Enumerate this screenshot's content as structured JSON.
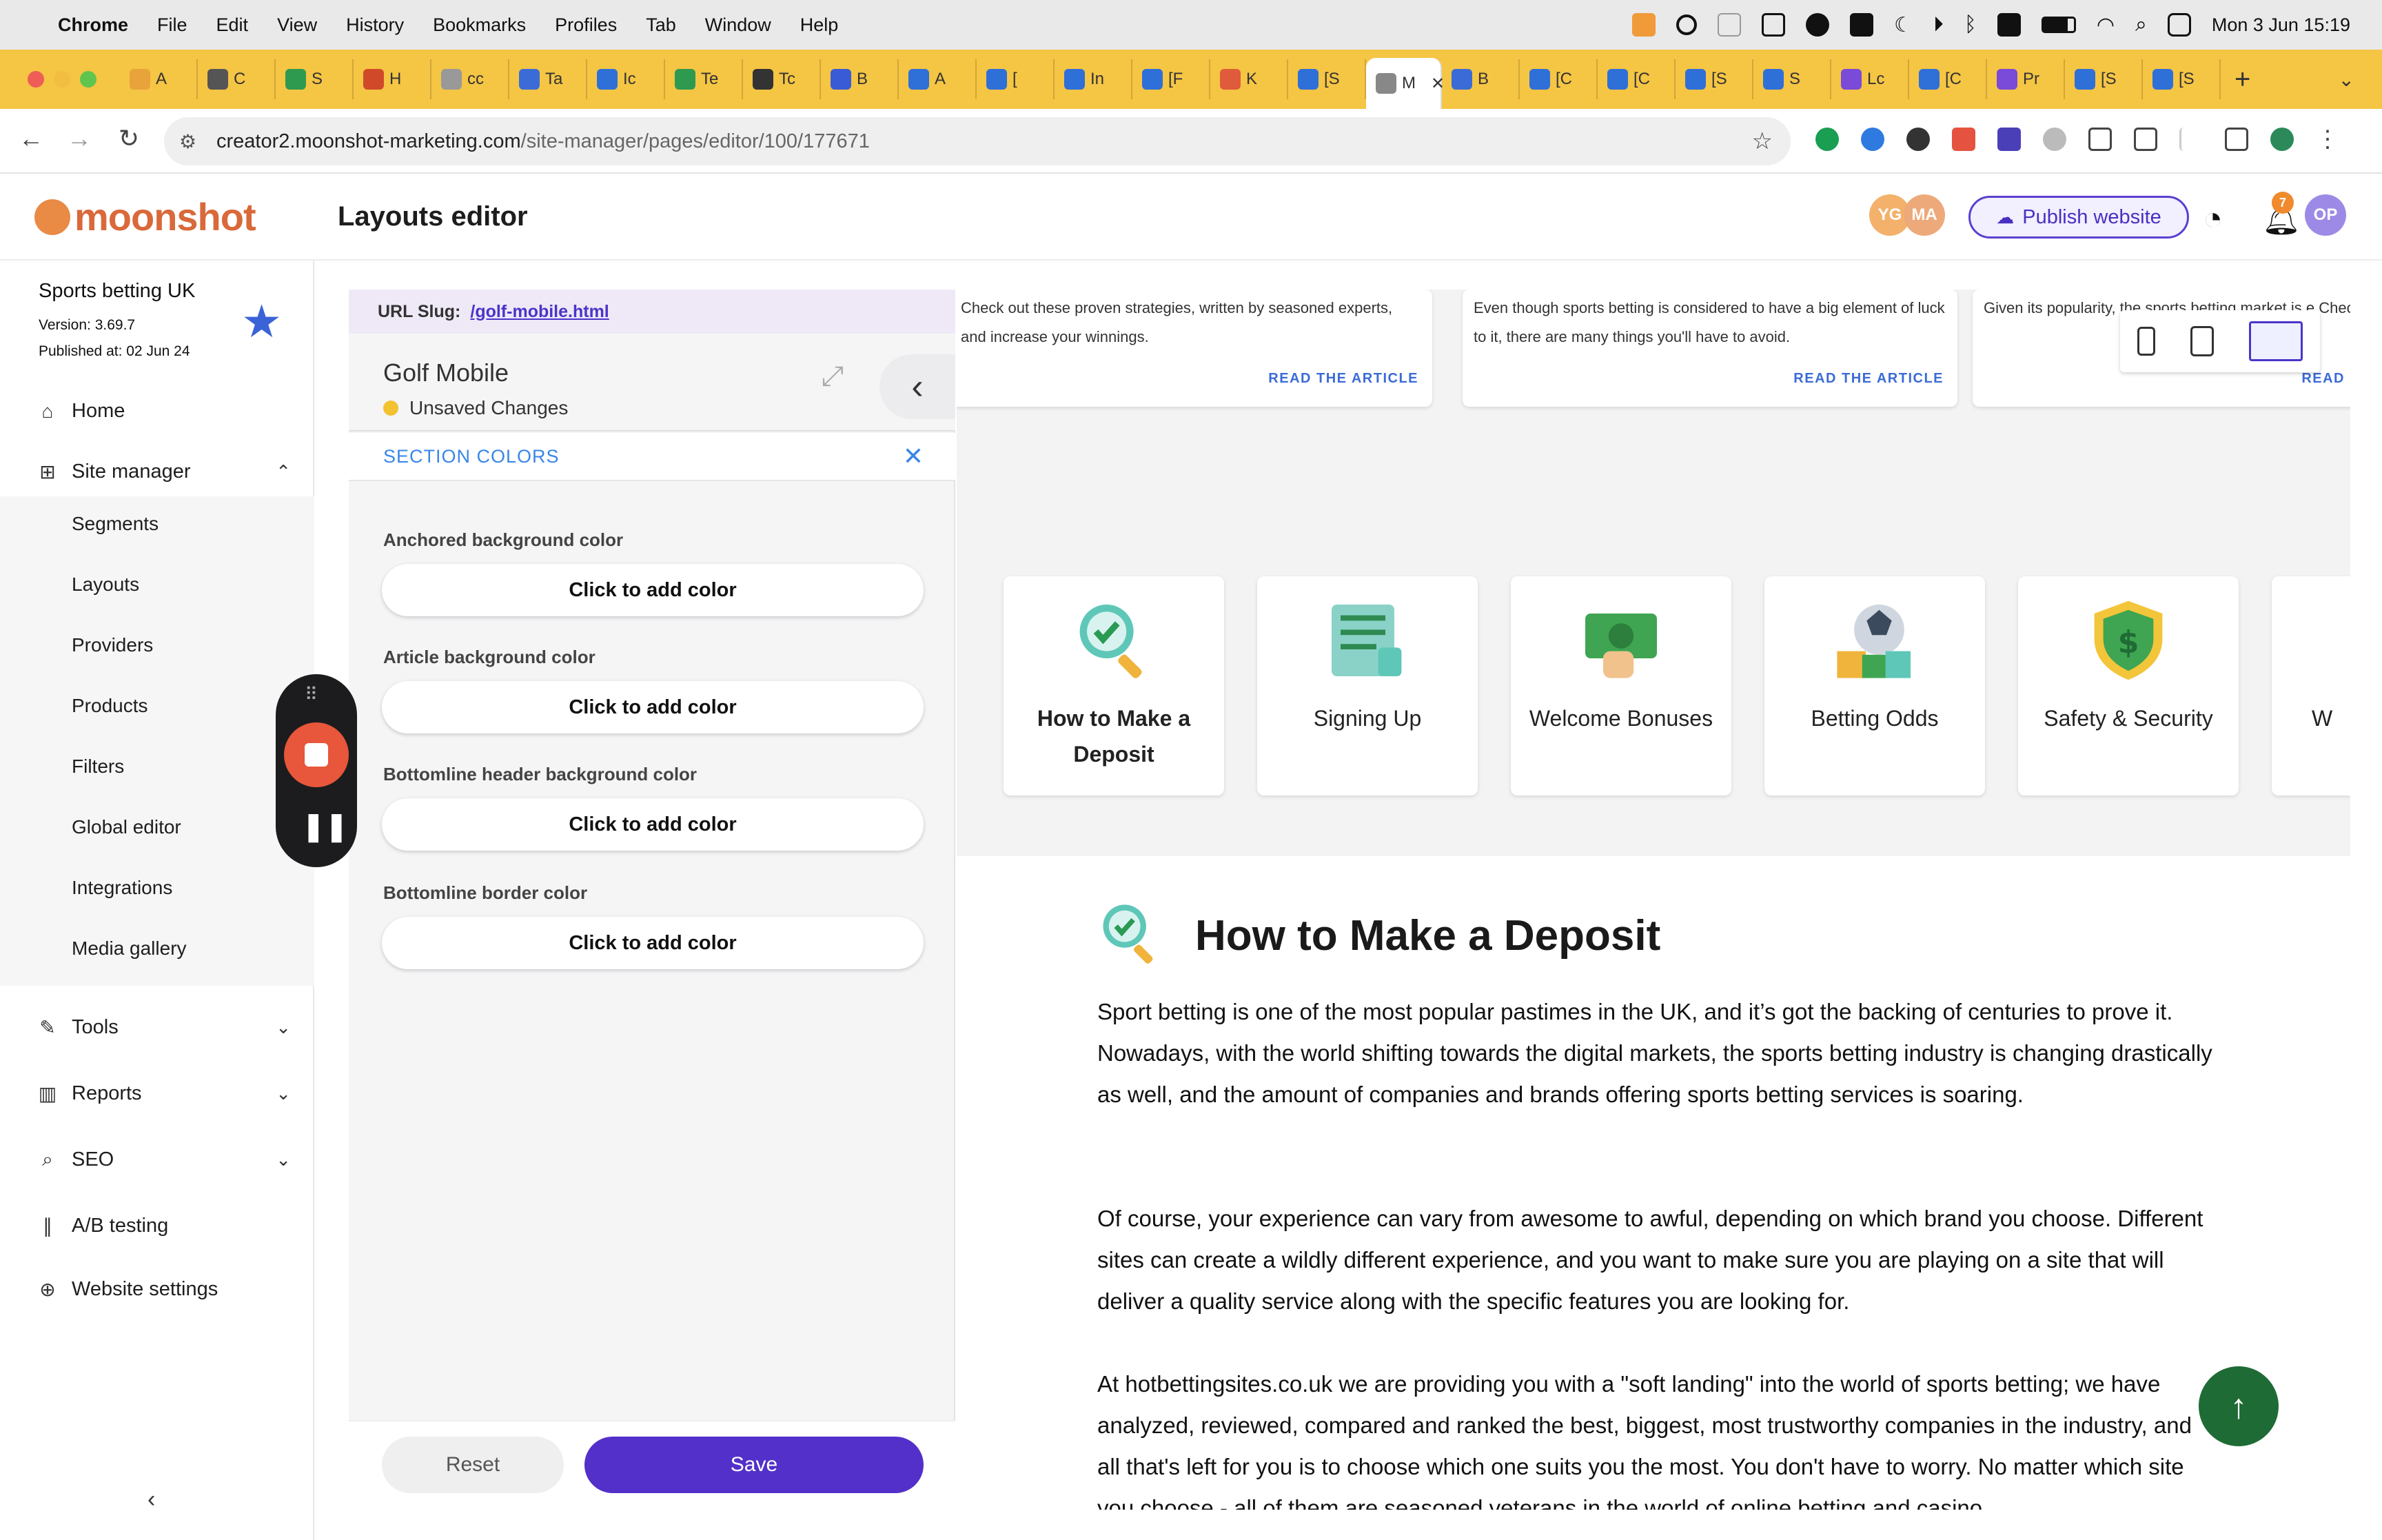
{
  "menubar": {
    "app": "Chrome",
    "items": [
      "File",
      "Edit",
      "View",
      "History",
      "Bookmarks",
      "Profiles",
      "Tab",
      "Window",
      "Help"
    ],
    "datetime": "Mon 3 Jun  15:19"
  },
  "tabs": [
    {
      "t": "A"
    },
    {
      "t": "C"
    },
    {
      "t": "S"
    },
    {
      "t": "H"
    },
    {
      "t": "cc"
    },
    {
      "t": "Ta"
    },
    {
      "t": "Ic"
    },
    {
      "t": "Te"
    },
    {
      "t": "Tc"
    },
    {
      "t": "B"
    },
    {
      "t": "A"
    },
    {
      "t": "["
    },
    {
      "t": "In"
    },
    {
      "t": "[F"
    },
    {
      "t": "K"
    },
    {
      "t": "[S"
    },
    {
      "t": "M"
    },
    {
      "t": "B"
    },
    {
      "t": "[C"
    },
    {
      "t": "[C"
    },
    {
      "t": "[S"
    },
    {
      "t": "S"
    },
    {
      "t": "Lc"
    },
    {
      "t": "[C"
    },
    {
      "t": "Pr"
    },
    {
      "t": "[S"
    },
    {
      "t": "[S"
    }
  ],
  "address": {
    "host": "creator2.moonshot-marketing.com",
    "path": "/site-manager/pages/editor/100/177671"
  },
  "header": {
    "logo": "moonshot",
    "title": "Layouts editor",
    "avatars": [
      "YG",
      "MA"
    ],
    "publish_label": "Publish website",
    "notif_count": "7",
    "user": "OP"
  },
  "site": {
    "name": "Sports betting UK",
    "version": "Version: 3.69.7",
    "published": "Published at: 02 Jun 24"
  },
  "sidebar": {
    "home": "Home",
    "site_manager": "Site manager",
    "sub": [
      "Segments",
      "Layouts",
      "Providers",
      "Products",
      "Filters",
      "Global editor",
      "Integrations",
      "Media gallery"
    ],
    "tools": "Tools",
    "reports": "Reports",
    "seo": "SEO",
    "ab": "A/B testing",
    "settings": "Website settings"
  },
  "panel": {
    "slug_label": "URL Slug:",
    "slug": "/golf-mobile.html",
    "layout_name": "Golf Mobile",
    "status": "Unsaved Changes",
    "section": "SECTION COLORS",
    "fields": [
      {
        "label": "Anchored background color",
        "btn": "Click to add color"
      },
      {
        "label": "Article background color",
        "btn": "Click to add color"
      },
      {
        "label": "Bottomline header background color",
        "btn": "Click to add color"
      },
      {
        "label": "Bottomline border color",
        "btn": "Click to add color"
      }
    ],
    "reset": "Reset",
    "save": "Save"
  },
  "preview": {
    "article_cards": [
      {
        "text": "Check out these proven strategies, written by seasoned experts, and increase your winnings.",
        "read": "READ THE ARTICLE"
      },
      {
        "text": "Even though sports betting is considered to have a big element of luck to it, there are many things you'll have to avoid.",
        "read": "READ THE ARTICLE"
      },
      {
        "text": "Given its popularity, the sports betting market is e Check this out to s          ty         your p",
        "read": "READ"
      }
    ],
    "topics": [
      "How to Make a Deposit",
      "Signing Up",
      "Welcome Bonuses",
      "Betting Odds",
      "Safety & Security",
      "W"
    ],
    "heading": "How to Make a Deposit",
    "paragraphs": [
      "Sport betting is one of the most popular pastimes in the UK, and it’s got the backing of centuries to prove it. Nowadays, with the world shifting towards the digital markets, the sports betting industry is changing drastically as well, and the amount of companies and brands offering sports betting services is soaring.",
      "Of course, your experience can vary from awesome to awful, depending on which brand you choose. Different sites can create a wildly different experience, and you want to make sure you are playing on a site that will deliver a quality service along with the specific features you are looking for.",
      "At hotbettingsites.co.uk we are providing you with a \"soft landing\" into the world of sports betting; we have analyzed, reviewed, compared and ranked the best, biggest, most trustworthy companies in the industry, and all that's left for you is to choose which one suits you the most. You don't have to worry. No matter which site you choose - all of them are seasoned veterans in the world of online betting and casino."
    ]
  },
  "colors": {
    "accent": "#5b3fd0",
    "tabstrip": "#f5c544",
    "status_dot": "#f2c230",
    "scroll_btn": "#1f6b35"
  }
}
